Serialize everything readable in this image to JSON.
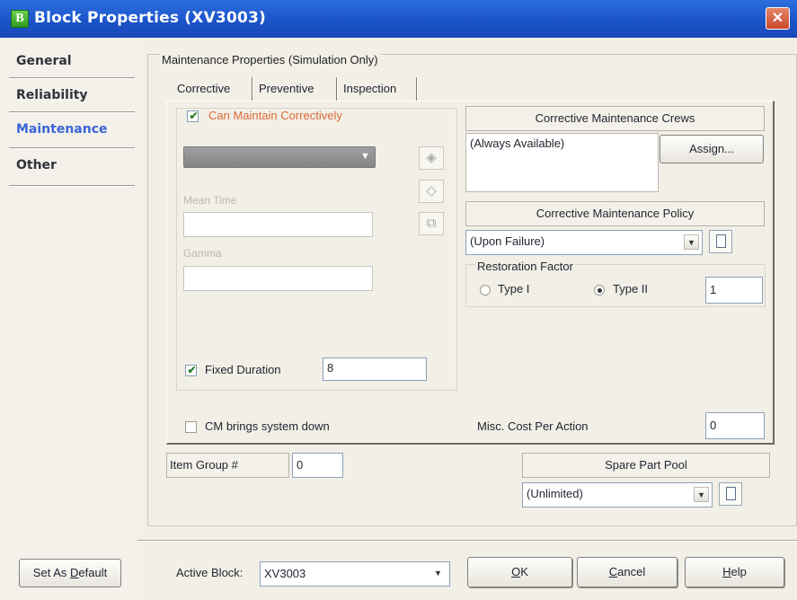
{
  "window": {
    "title": "Block Properties (XV3003)",
    "app_icon_letter": "B",
    "close_glyph": "✕"
  },
  "nav": {
    "items": [
      {
        "label": "General",
        "active": false
      },
      {
        "label": "Reliability",
        "active": false
      },
      {
        "label": "Maintenance",
        "active": true
      },
      {
        "label": "Other",
        "active": false
      }
    ]
  },
  "group_title": "Maintenance Properties (Simulation Only)",
  "tabs": [
    {
      "label": "Corrective",
      "selected": true
    },
    {
      "label": "Preventive",
      "selected": false
    },
    {
      "label": "Inspection",
      "selected": false
    }
  ],
  "corrective": {
    "can_maintain_label": "Can Maintain Correctively",
    "can_maintain_checked": true,
    "mean_time_label": "Mean Time",
    "mean_time_value": "",
    "gamma_label": "Gamma",
    "gamma_value": "",
    "fixed_duration_label": "Fixed Duration",
    "fixed_duration_checked": true,
    "fixed_duration_value": "8",
    "cm_brings_down_label": "CM brings system down",
    "cm_brings_down_checked": false,
    "misc_cost_label": "Misc. Cost Per Action",
    "misc_cost_value": "0"
  },
  "crews": {
    "header": "Corrective Maintenance Crews",
    "value": "(Always Available)",
    "assign_label": "Assign..."
  },
  "policy": {
    "header": "Corrective Maintenance Policy",
    "selected": "(Upon Failure)"
  },
  "restoration": {
    "label": "Restoration Factor",
    "type1_label": "Type I",
    "type2_label": "Type II",
    "selected": "Type II",
    "value": "1"
  },
  "item_group": {
    "label": "Item Group #",
    "value": "0"
  },
  "spare_pool": {
    "header": "Spare Part Pool",
    "selected": "(Unlimited)"
  },
  "footer": {
    "set_default_label": "Set As Default",
    "active_block_label": "Active Block:",
    "active_block_value": "XV3003",
    "ok_label": "OK",
    "cancel_label": "Cancel",
    "help_label": "Help"
  },
  "colors": {
    "title_bar": "#1b54c9",
    "active_nav": "#3a64d8",
    "can_maintain_label": "#e06a3a"
  }
}
